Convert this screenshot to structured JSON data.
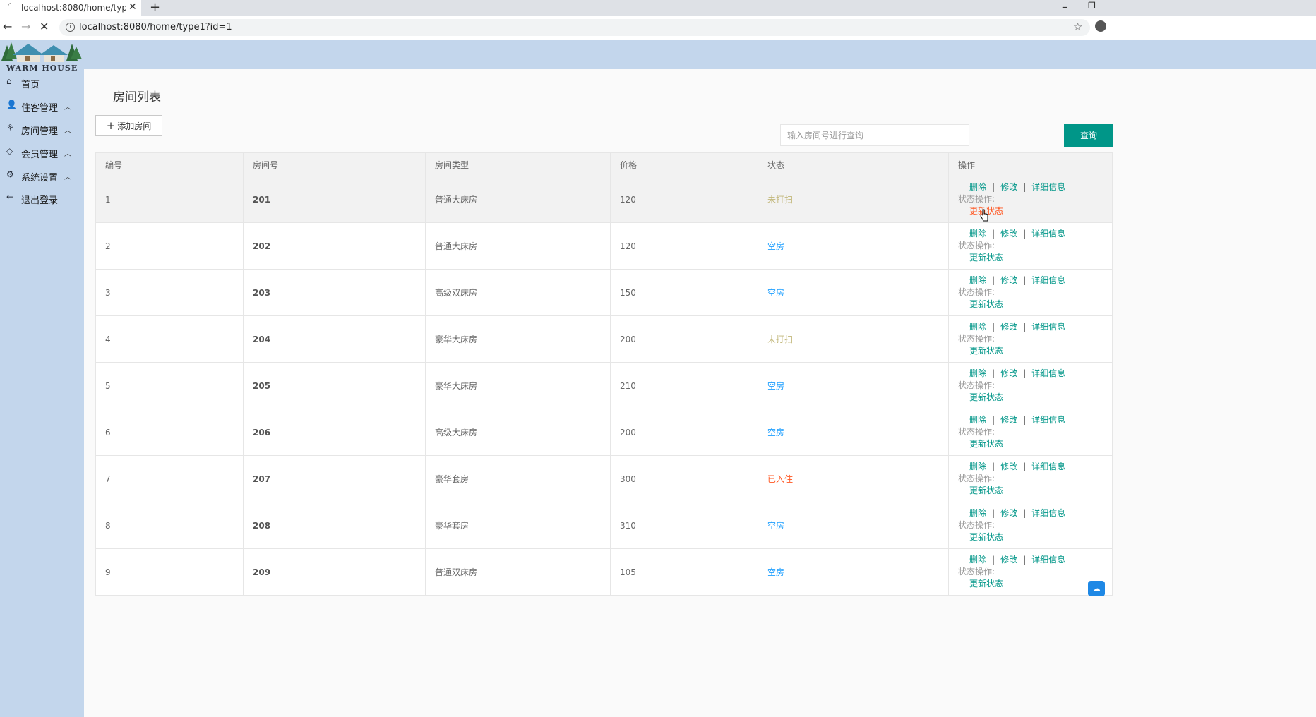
{
  "browser": {
    "tab_title": "localhost:8080/home/type1?id=1",
    "url": "localhost:8080/home/type1?id=1"
  },
  "app": {
    "logo_text": "WARM HOUSE"
  },
  "sidebar": {
    "items": [
      {
        "label": "首页",
        "icon": "home-icon"
      },
      {
        "label": "住客管理",
        "icon": "user-icon"
      },
      {
        "label": "房间管理",
        "icon": "palm-tree-icon"
      },
      {
        "label": "会员管理",
        "icon": "diamond-icon"
      },
      {
        "label": "系统设置",
        "icon": "gear-icon"
      },
      {
        "label": "退出登录",
        "icon": "arrow-left-icon"
      }
    ]
  },
  "main": {
    "title": "房间列表",
    "add_button": "添加房间",
    "search_placeholder": "输入房间号进行查询",
    "query_button": "查询"
  },
  "table": {
    "headers": [
      "编号",
      "房间号",
      "房间类型",
      "价格",
      "状态",
      "操作"
    ],
    "actions": {
      "delete": "删除",
      "edit": "修改",
      "detail": "详细信息",
      "status_label": "状态操作:",
      "update_status": "更新状态",
      "separator": "|"
    },
    "rows": [
      {
        "id": "1",
        "room": "201",
        "type": "普通大床房",
        "price": "120",
        "status": "未打扫"
      },
      {
        "id": "2",
        "room": "202",
        "type": "普通大床房",
        "price": "120",
        "status": "空房"
      },
      {
        "id": "3",
        "room": "203",
        "type": "高级双床房",
        "price": "150",
        "status": "空房"
      },
      {
        "id": "4",
        "room": "204",
        "type": "豪华大床房",
        "price": "200",
        "status": "未打扫"
      },
      {
        "id": "5",
        "room": "205",
        "type": "豪华大床房",
        "price": "210",
        "status": "空房"
      },
      {
        "id": "6",
        "room": "206",
        "type": "高级大床房",
        "price": "200",
        "status": "空房"
      },
      {
        "id": "7",
        "room": "207",
        "type": "豪华套房",
        "price": "300",
        "status": "已入住"
      },
      {
        "id": "8",
        "room": "208",
        "type": "豪华套房",
        "price": "310",
        "status": "空房"
      },
      {
        "id": "9",
        "room": "209",
        "type": "普通双床房",
        "price": "105",
        "status": "空房"
      }
    ]
  },
  "colors": {
    "sidebar_bg": "#c3d6ec",
    "accent_green": "#009688",
    "status_blue": "#1e9fff",
    "status_red": "#ff5722"
  }
}
